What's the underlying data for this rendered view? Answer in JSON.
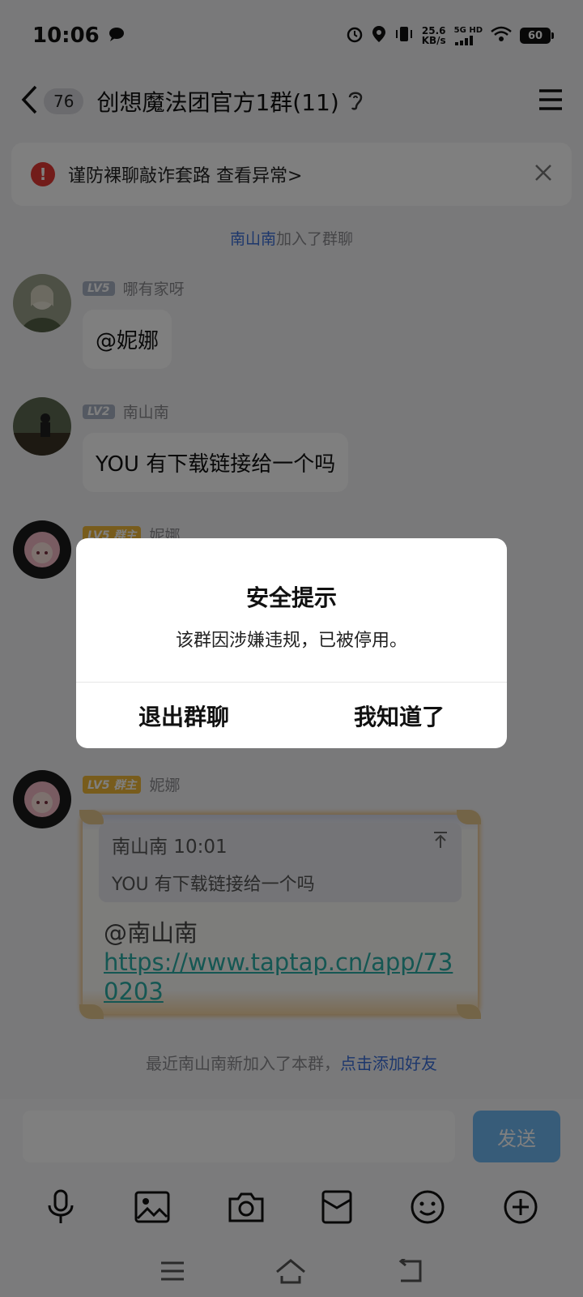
{
  "status_bar": {
    "time": "10:06",
    "net_speed_value": "25.6",
    "net_speed_unit": "KB/s",
    "network_label": "5G HD",
    "battery": "60",
    "icons": [
      "message-bubble-icon",
      "alarm-icon",
      "location-icon",
      "vibrate-icon",
      "signal-icon",
      "wifi-icon",
      "battery-icon"
    ]
  },
  "header": {
    "unread_count": "76",
    "title": "创想魔法团官方1群(11)"
  },
  "warning_banner": {
    "text": "谨防裸聊敲诈套路 查看异常>"
  },
  "system_message": {
    "name": "南山南",
    "text": "加入了群聊"
  },
  "messages": [
    {
      "level": "LV5",
      "role": "",
      "nickname": "哪有家呀",
      "text": "@妮娜"
    },
    {
      "level": "LV2",
      "role": "",
      "nickname": "南山南",
      "text": "YOU 有下载链接给一个吗"
    },
    {
      "level": "LV5",
      "role": "群主",
      "nickname": "妮娜"
    },
    {
      "level": "LV5",
      "role": "群主",
      "nickname": "妮娜",
      "quote_header": "南山南 10:01",
      "quote_text": "YOU 有下载链接给一个吗",
      "mention": "@南山南",
      "link": "https://www.taptap.cn/app/730203"
    }
  ],
  "recent_join": {
    "text": "最近南山南新加入了本群，",
    "action": "点击添加好友"
  },
  "input_bar": {
    "send_label": "发送"
  },
  "dialog": {
    "title": "安全提示",
    "message": "该群因涉嫌违规，已被停用。",
    "exit_label": "退出群聊",
    "ok_label": "我知道了"
  },
  "colors": {
    "accent_blue": "#3a6fd9",
    "send_blue": "#6fb8f3",
    "warning_red": "#e53935",
    "owner_gold": "#f1b838",
    "link_teal": "#2aaea6"
  }
}
